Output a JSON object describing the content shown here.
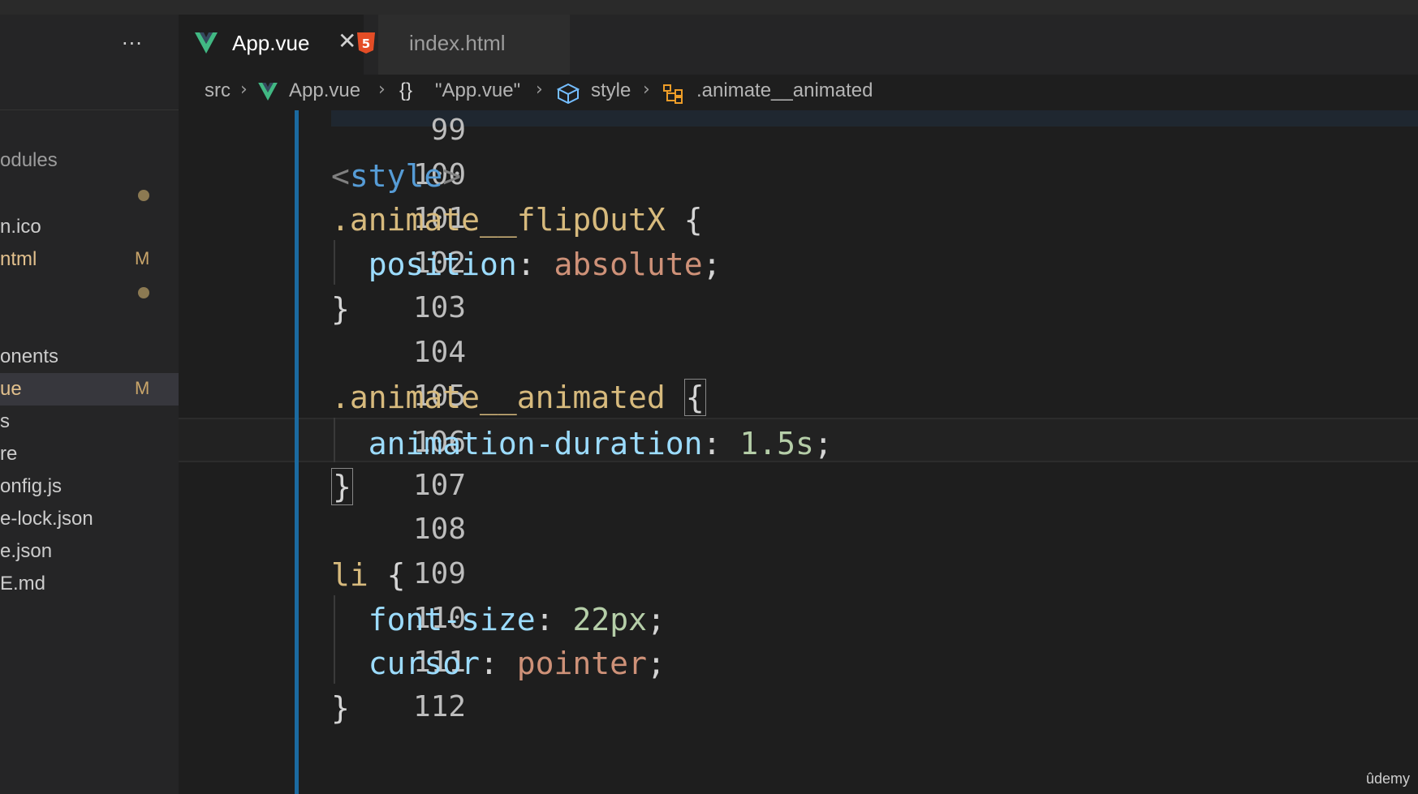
{
  "sidebar": {
    "items": [
      {
        "label": "odules",
        "badge": "",
        "dot": false,
        "state": "dim"
      },
      {
        "label": "",
        "badge": "",
        "dot": true,
        "state": "normal"
      },
      {
        "label": "n.ico",
        "badge": "",
        "dot": false,
        "state": "normal"
      },
      {
        "label": "ntml",
        "badge": "M",
        "dot": false,
        "state": "modified"
      },
      {
        "label": "",
        "badge": "",
        "dot": true,
        "state": "normal"
      },
      {
        "label": "onents",
        "badge": "",
        "dot": false,
        "state": "normal"
      },
      {
        "label": "ue",
        "badge": "M",
        "dot": false,
        "state": "modified"
      },
      {
        "label": "s",
        "badge": "",
        "dot": false,
        "state": "normal"
      },
      {
        "label": "re",
        "badge": "",
        "dot": false,
        "state": "normal"
      },
      {
        "label": "onfig.js",
        "badge": "",
        "dot": false,
        "state": "normal"
      },
      {
        "label": "e-lock.json",
        "badge": "",
        "dot": false,
        "state": "normal"
      },
      {
        "label": "e.json",
        "badge": "",
        "dot": false,
        "state": "normal"
      },
      {
        "label": "E.md",
        "badge": "",
        "dot": false,
        "state": "normal"
      }
    ]
  },
  "tabs": {
    "active": {
      "label": "App.vue",
      "icon": "vue-icon"
    },
    "inactive": {
      "label": "index.html",
      "icon": "html5-icon"
    }
  },
  "breadcrumb": {
    "src": "src",
    "file": "App.vue",
    "scope": "\"App.vue\"",
    "scope_icon": "{}",
    "style": "style",
    "selector": ".animate__animated"
  },
  "editor": {
    "lines": [
      {
        "num": "99",
        "tokens": []
      },
      {
        "num": "100",
        "tokens": [
          {
            "t": "<",
            "c": "t-punct"
          },
          {
            "t": "style",
            "c": "t-tag"
          },
          {
            "t": ">",
            "c": "t-punct"
          }
        ]
      },
      {
        "num": "101",
        "tokens": [
          {
            "t": ".animate__flipOutX",
            "c": "t-sel"
          },
          {
            "t": " {",
            "c": "t-text"
          }
        ]
      },
      {
        "num": "102",
        "tokens": [
          {
            "t": "  position",
            "c": "t-prop"
          },
          {
            "t": ": ",
            "c": "t-text"
          },
          {
            "t": "absolute",
            "c": "t-val"
          },
          {
            "t": ";",
            "c": "t-text"
          }
        ]
      },
      {
        "num": "103",
        "tokens": [
          {
            "t": "}",
            "c": "t-text"
          }
        ]
      },
      {
        "num": "104",
        "tokens": []
      },
      {
        "num": "105",
        "tokens": [
          {
            "t": ".animate__animated",
            "c": "t-sel"
          },
          {
            "t": " ",
            "c": "t-text"
          },
          {
            "t": "{",
            "c": "t-text bracket-box"
          }
        ]
      },
      {
        "num": "106",
        "tokens": [
          {
            "t": "  animation-duration",
            "c": "t-prop"
          },
          {
            "t": ": ",
            "c": "t-text"
          },
          {
            "t": "1.5s",
            "c": "t-num"
          },
          {
            "t": ";",
            "c": "t-text"
          }
        ]
      },
      {
        "num": "107",
        "tokens": [
          {
            "t": "}",
            "c": "t-text bracket-box"
          }
        ]
      },
      {
        "num": "108",
        "tokens": []
      },
      {
        "num": "109",
        "tokens": [
          {
            "t": "li",
            "c": "t-sel"
          },
          {
            "t": " {",
            "c": "t-text"
          }
        ]
      },
      {
        "num": "110",
        "tokens": [
          {
            "t": "  font-size",
            "c": "t-prop"
          },
          {
            "t": ": ",
            "c": "t-text"
          },
          {
            "t": "22px",
            "c": "t-num"
          },
          {
            "t": ";",
            "c": "t-text"
          }
        ]
      },
      {
        "num": "111",
        "tokens": [
          {
            "t": "  cursor",
            "c": "t-prop"
          },
          {
            "t": ": ",
            "c": "t-text"
          },
          {
            "t": "pointer",
            "c": "t-val"
          },
          {
            "t": ";",
            "c": "t-text"
          }
        ]
      },
      {
        "num": "112",
        "tokens": [
          {
            "t": "}",
            "c": "t-text"
          }
        ]
      }
    ],
    "current_line": "106"
  },
  "watermark": "ûdemy",
  "colors": {
    "gutter_accent": "#1b6aa0",
    "vue_green": "#41b883",
    "html5_orange": "#e44d26"
  }
}
